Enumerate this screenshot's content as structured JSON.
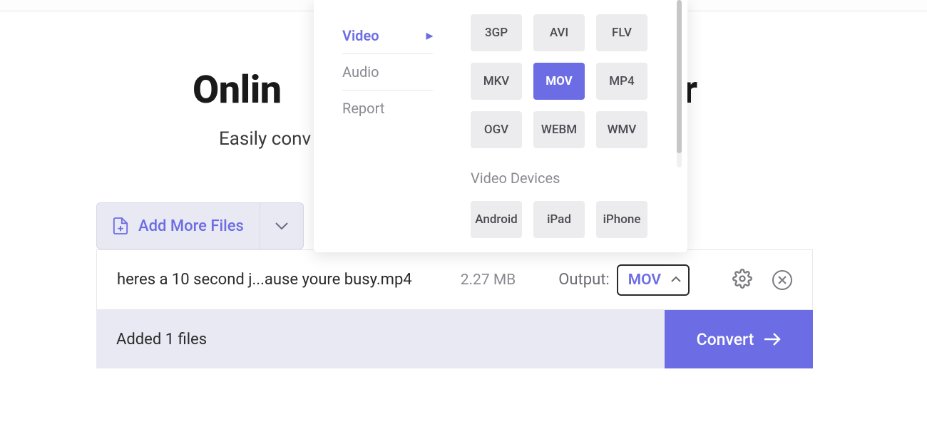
{
  "header": {
    "title_visible_left": "Onlin",
    "title_visible_right": "r",
    "subtitle_visible": "Easily conv"
  },
  "addFiles": {
    "label": "Add More Files"
  },
  "fileRow": {
    "name": "heres a 10 second j...ause youre busy.mp4",
    "size": "2.27 MB",
    "outputLabel": "Output:",
    "outputValue": "MOV"
  },
  "statusBar": {
    "text": "Added 1 files",
    "convertLabel": "Convert"
  },
  "formatPopup": {
    "sidebar": {
      "video": "Video",
      "audio": "Audio",
      "report": "Report"
    },
    "videoFormats": [
      "3GP",
      "AVI",
      "FLV",
      "MKV",
      "MOV",
      "MP4",
      "OGV",
      "WEBM",
      "WMV"
    ],
    "selectedFormat": "MOV",
    "deviceSectionLabel": "Video Devices",
    "deviceFormats": [
      "Android",
      "iPad",
      "iPhone"
    ]
  }
}
